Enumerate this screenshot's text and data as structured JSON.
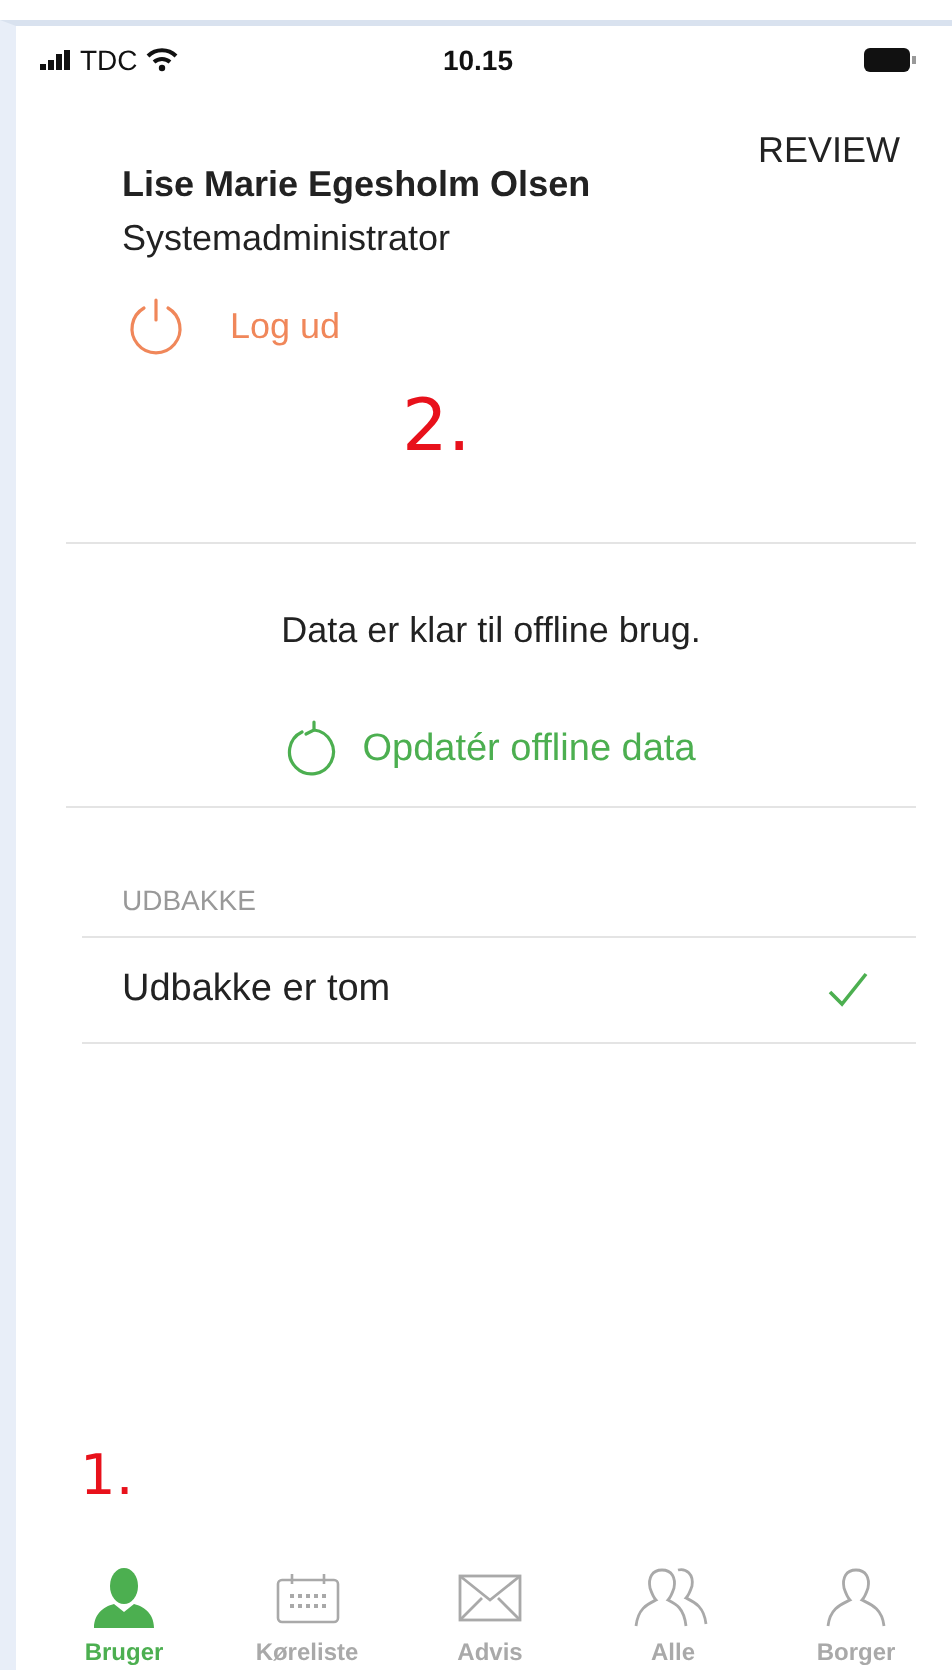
{
  "status_bar": {
    "carrier": "TDC",
    "time": "10.15"
  },
  "header": {
    "action": "REVIEW",
    "user_name": "Lise Marie Egesholm Olsen",
    "role": "Systemadministrator",
    "logout": "Log ud"
  },
  "sync": {
    "message": "Data er klar til offline brug.",
    "refresh": "Opdatér offline data"
  },
  "outbox": {
    "heading": "UDBAKKE",
    "rows": [
      {
        "label": "Udbakke er tom",
        "checked": true
      }
    ]
  },
  "tabs": [
    {
      "label": "Bruger",
      "kind": "user",
      "selected": true
    },
    {
      "label": "Køreliste",
      "kind": "calendar",
      "selected": false
    },
    {
      "label": "Advis",
      "kind": "mail",
      "selected": false
    },
    {
      "label": "Alle",
      "kind": "group",
      "selected": false
    },
    {
      "label": "Borger",
      "kind": "person",
      "selected": false
    }
  ],
  "annotations": [
    {
      "text": "2.",
      "kind": "logout"
    },
    {
      "text": "1.",
      "kind": "tabs"
    }
  ]
}
